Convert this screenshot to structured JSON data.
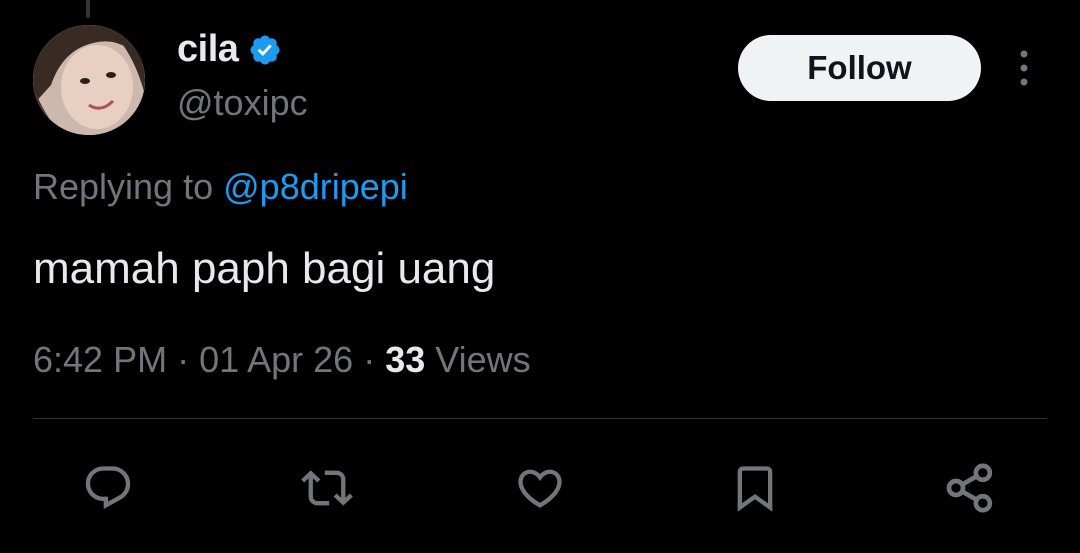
{
  "author": {
    "display_name": "cila",
    "handle": "@toxipc",
    "verified": true,
    "verified_color": "#1d9bf0"
  },
  "follow_button": {
    "label": "Follow"
  },
  "reply": {
    "prefix": "Replying to",
    "mention": "@p8dripepi"
  },
  "tweet": {
    "text": "mamah paph bagi uang"
  },
  "meta": {
    "time": "6:42 PM",
    "separator": " · ",
    "date": "01 Apr 26",
    "views_count": "33",
    "views_label": "Views"
  },
  "actions": [
    {
      "icon": "reply-icon"
    },
    {
      "icon": "retweet-icon"
    },
    {
      "icon": "like-icon"
    },
    {
      "icon": "bookmark-icon"
    },
    {
      "icon": "share-icon"
    }
  ],
  "colors": {
    "background": "#000000",
    "primary_text": "#e7e9ea",
    "secondary_text": "#71767b",
    "accent": "#1d9bf0",
    "divider": "#2f3336"
  }
}
